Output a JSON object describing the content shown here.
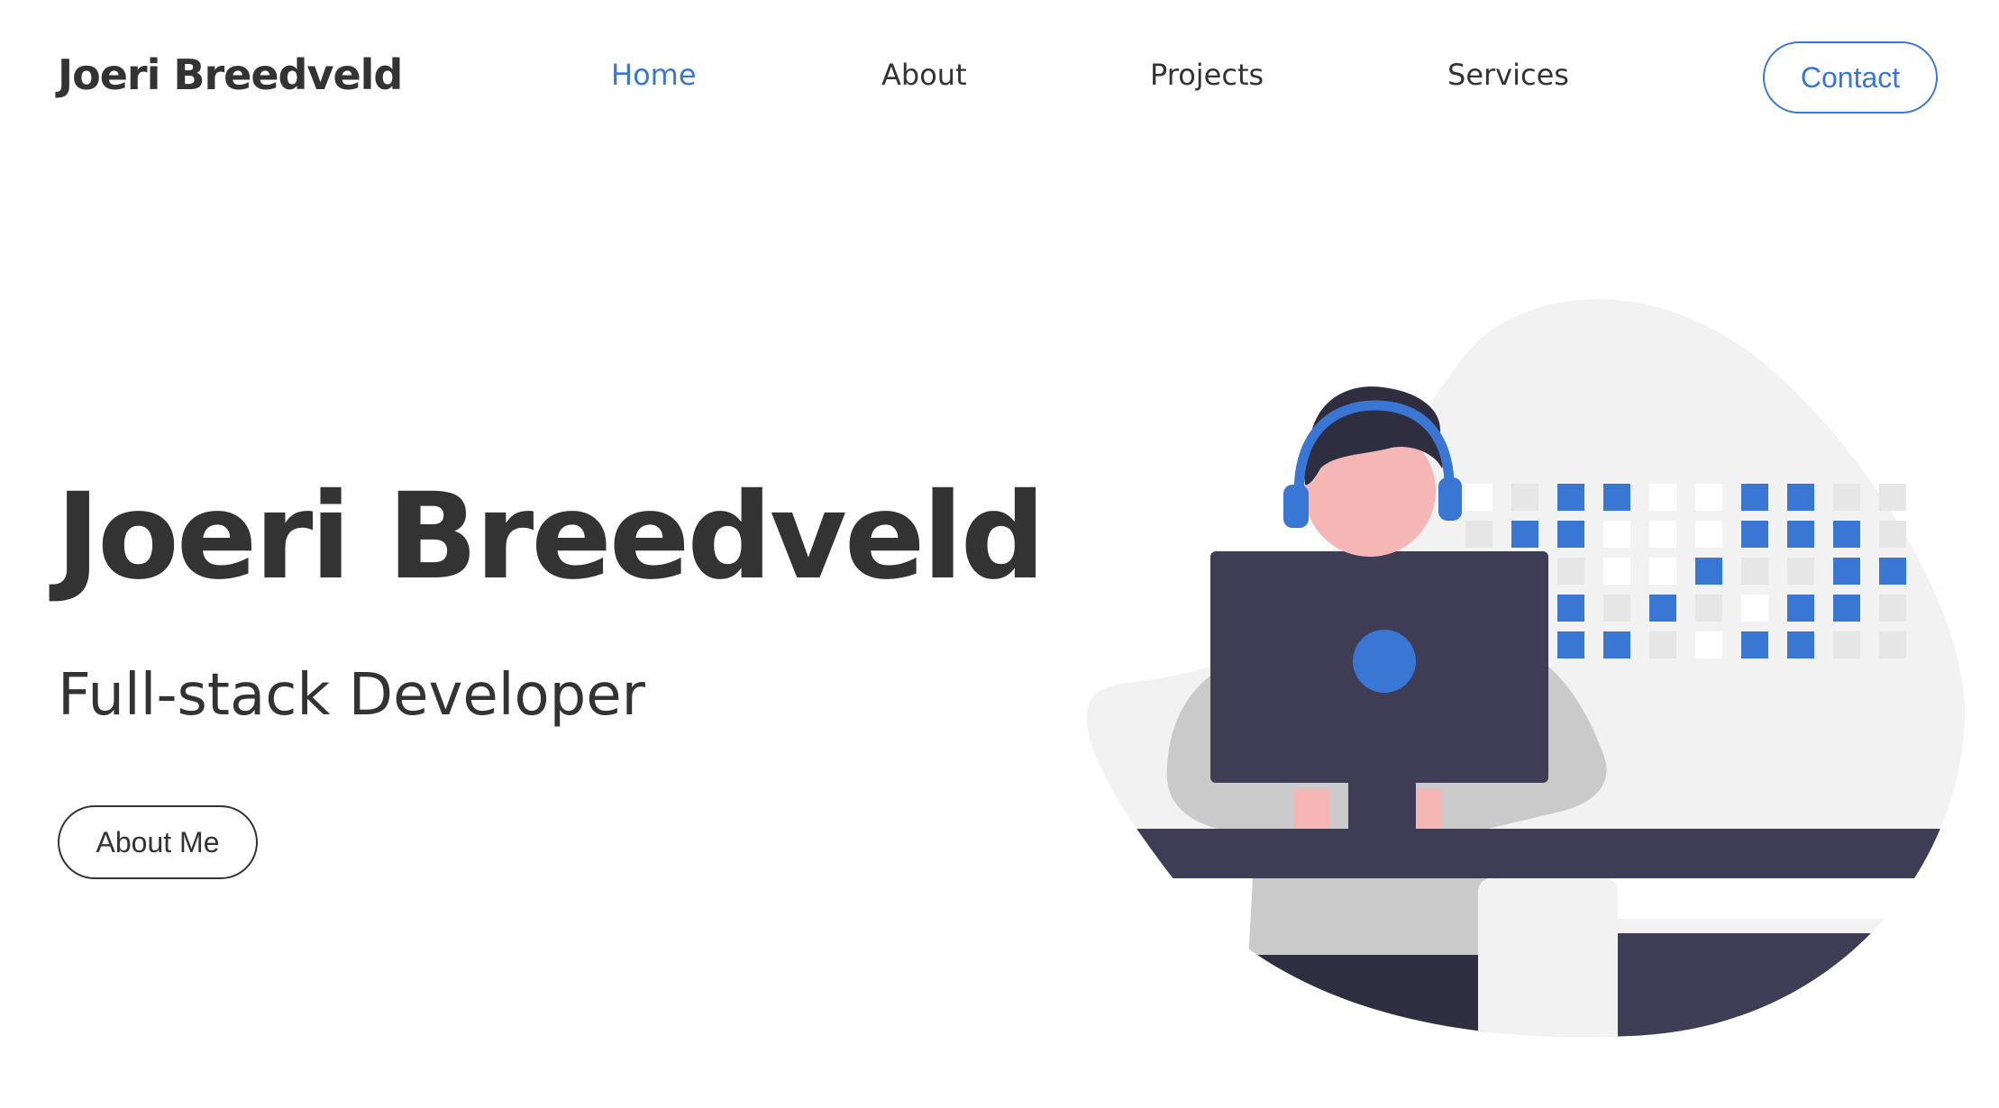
{
  "header": {
    "brand": "Joeri Breedveld",
    "nav": {
      "home": "Home",
      "about": "About",
      "projects": "Projects",
      "services": "Services"
    },
    "contact_label": "Contact"
  },
  "hero": {
    "title": "Joeri Breedveld",
    "subtitle": "Full-stack Developer",
    "cta_label": "About Me"
  },
  "colors": {
    "accent": "#3a76d4",
    "text": "#333333",
    "dark_navy": "#3f3d56",
    "skin": "#f4b7b6",
    "light_gray": "#f2f2f2",
    "mid_gray": "#cacaca"
  },
  "illustration": {
    "icon": "developer-with-headset-illustration"
  }
}
